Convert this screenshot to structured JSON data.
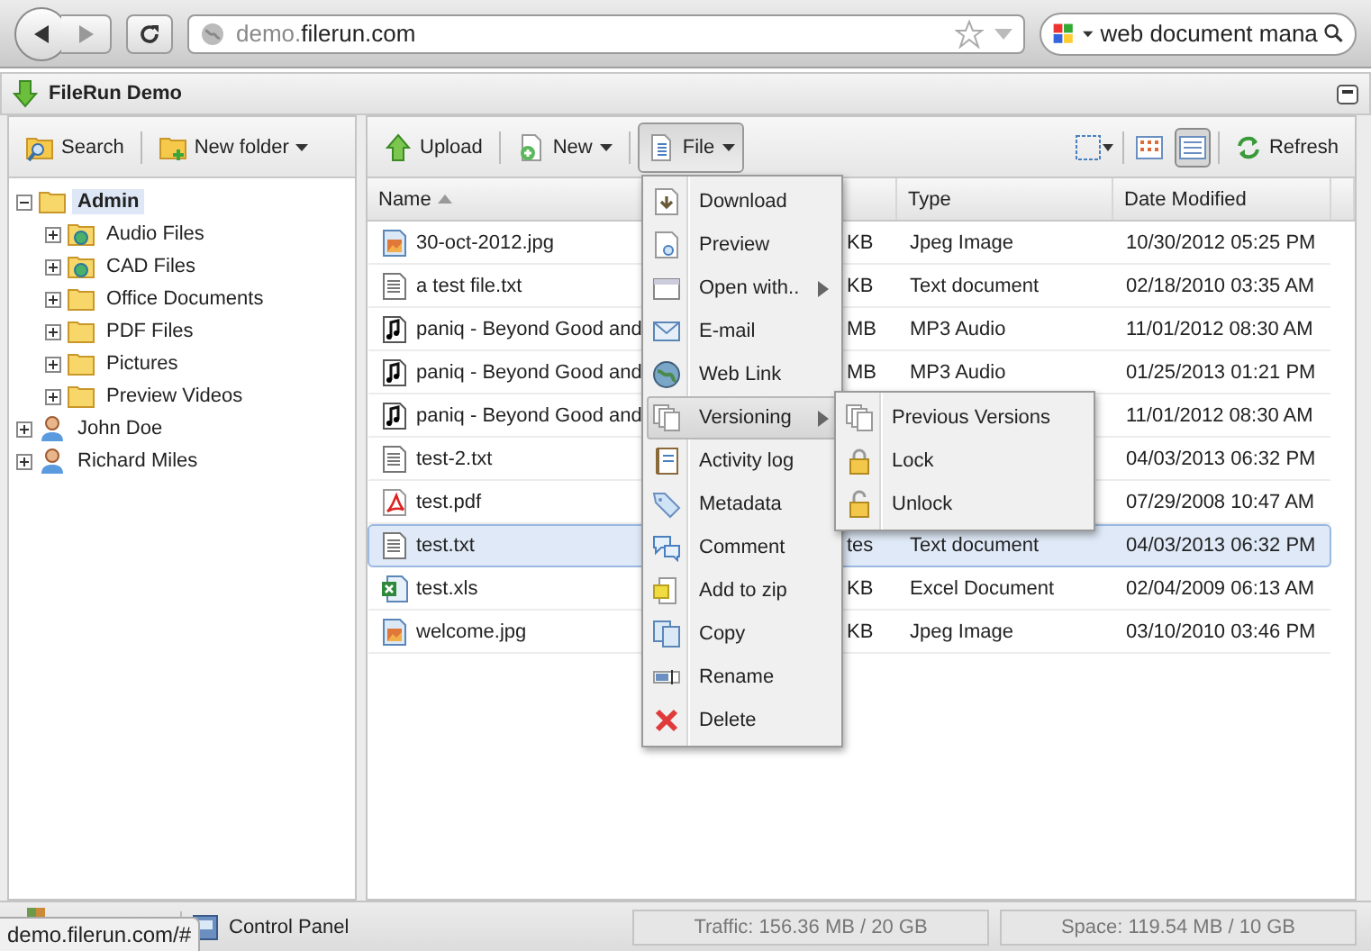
{
  "browser": {
    "url": {
      "prefix": "demo.",
      "domain": "filerun.com"
    },
    "search": {
      "value": "web document mana"
    }
  },
  "app": {
    "title": "FileRun Demo"
  },
  "left_toolbar": [
    {
      "label": "Search",
      "kind": "search",
      "dropdown": false
    },
    {
      "label": "New folder",
      "kind": "new-folder",
      "dropdown": true
    }
  ],
  "toolbar": [
    {
      "label": "Upload",
      "kind": "upload",
      "dropdown": false,
      "pressed": false
    },
    {
      "label": "New",
      "kind": "new",
      "dropdown": true,
      "pressed": false
    },
    {
      "label": "File",
      "kind": "file",
      "dropdown": true,
      "pressed": true
    }
  ],
  "view_buttons": [
    {
      "kind": "thumbnails",
      "selected": false
    },
    {
      "kind": "list",
      "selected": true
    }
  ],
  "refresh": {
    "label": "Refresh"
  },
  "tree": [
    {
      "label": "Admin",
      "kind": "folder",
      "expanded": true,
      "selected": true,
      "children": [
        {
          "label": "Audio Files",
          "kind": "shared",
          "expanded": false,
          "selected": false
        },
        {
          "label": "CAD Files",
          "kind": "shared",
          "expanded": false,
          "selected": false
        },
        {
          "label": "Office Documents",
          "kind": "folder",
          "expanded": false,
          "selected": false
        },
        {
          "label": "PDF Files",
          "kind": "folder",
          "expanded": false,
          "selected": false
        },
        {
          "label": "Pictures",
          "kind": "folder",
          "expanded": false,
          "selected": false
        },
        {
          "label": "Preview Videos",
          "kind": "folder",
          "expanded": false,
          "selected": false
        }
      ]
    },
    {
      "label": "John Doe",
      "kind": "user",
      "expanded": false,
      "selected": false
    },
    {
      "label": "Richard Miles",
      "kind": "user",
      "expanded": false,
      "selected": false
    }
  ],
  "grid": {
    "columns": [
      {
        "label": "Name",
        "sorted": true
      },
      {
        "label": "Type",
        "sorted": false
      },
      {
        "label": "Date Modified",
        "sorted": false
      }
    ],
    "rows": [
      {
        "name": "30-oct-2012.jpg",
        "kind": "image",
        "size": "KB",
        "type": "Jpeg Image",
        "date": "10/30/2012 05:25 PM",
        "selected": false
      },
      {
        "name": "a test file.txt",
        "kind": "text",
        "size": "KB",
        "type": "Text document",
        "date": "02/18/2010 03:35 AM",
        "selected": false
      },
      {
        "name": "paniq - Beyond Good and",
        "kind": "audio",
        "size": "MB",
        "type": "MP3 Audio",
        "date": "11/01/2012 08:30 AM",
        "selected": false
      },
      {
        "name": "paniq - Beyond Good and",
        "kind": "audio",
        "size": "MB",
        "type": "MP3 Audio",
        "date": "01/25/2013 01:21 PM",
        "selected": false
      },
      {
        "name": "paniq - Beyond Good and",
        "kind": "audio",
        "date": "11/01/2012 08:30 AM",
        "selected": false
      },
      {
        "name": "test-2.txt",
        "kind": "text",
        "date": "04/03/2013 06:32 PM",
        "selected": false
      },
      {
        "name": "test.pdf",
        "kind": "pdf",
        "date": "07/29/2008 10:47 AM",
        "selected": false
      },
      {
        "name": "test.txt",
        "kind": "text",
        "size": "tes",
        "type": "Text document",
        "date": "04/03/2013 06:32 PM",
        "selected": true
      },
      {
        "name": "test.xls",
        "kind": "excel",
        "size": "KB",
        "type": "Excel Document",
        "date": "02/04/2009 06:13 AM",
        "selected": false
      },
      {
        "name": "welcome.jpg",
        "kind": "image",
        "size": "KB",
        "type": "Jpeg Image",
        "date": "03/10/2010 03:46 PM",
        "selected": false
      }
    ]
  },
  "file_menu": {
    "items": [
      {
        "label": "Download",
        "kind": "download",
        "submenu": false,
        "selected": false
      },
      {
        "label": "Preview",
        "kind": "preview",
        "submenu": false,
        "selected": false
      },
      {
        "label": "Open with..",
        "kind": "window",
        "submenu": true,
        "selected": false
      },
      {
        "label": "E-mail",
        "kind": "email",
        "submenu": false,
        "selected": false
      },
      {
        "label": "Web Link",
        "kind": "globe",
        "submenu": false,
        "selected": false
      },
      {
        "label": "Versioning",
        "kind": "versions",
        "submenu": true,
        "selected": true
      },
      {
        "label": "Activity log",
        "kind": "log",
        "submenu": false,
        "selected": false
      },
      {
        "label": "Metadata",
        "kind": "tag",
        "submenu": false,
        "selected": false
      },
      {
        "label": "Comment",
        "kind": "comment",
        "submenu": false,
        "selected": false
      },
      {
        "label": "Add to zip",
        "kind": "zip",
        "submenu": false,
        "selected": false
      },
      {
        "label": "Copy",
        "kind": "copy",
        "submenu": false,
        "selected": false
      },
      {
        "label": "Rename",
        "kind": "rename",
        "submenu": false,
        "selected": false
      },
      {
        "label": "Delete",
        "kind": "delete",
        "submenu": false,
        "selected": false
      }
    ]
  },
  "versioning_menu": {
    "items": [
      {
        "label": "Previous Versions",
        "kind": "versions"
      },
      {
        "label": "Lock",
        "kind": "lock"
      },
      {
        "label": "Unlock",
        "kind": "unlock"
      }
    ]
  },
  "footer": {
    "control_panel": "Control Panel",
    "traffic": "Traffic: 156.36 MB / 20 GB",
    "space": "Space: 119.54 MB / 10 GB",
    "status_url": "demo.filerun.com/#"
  }
}
